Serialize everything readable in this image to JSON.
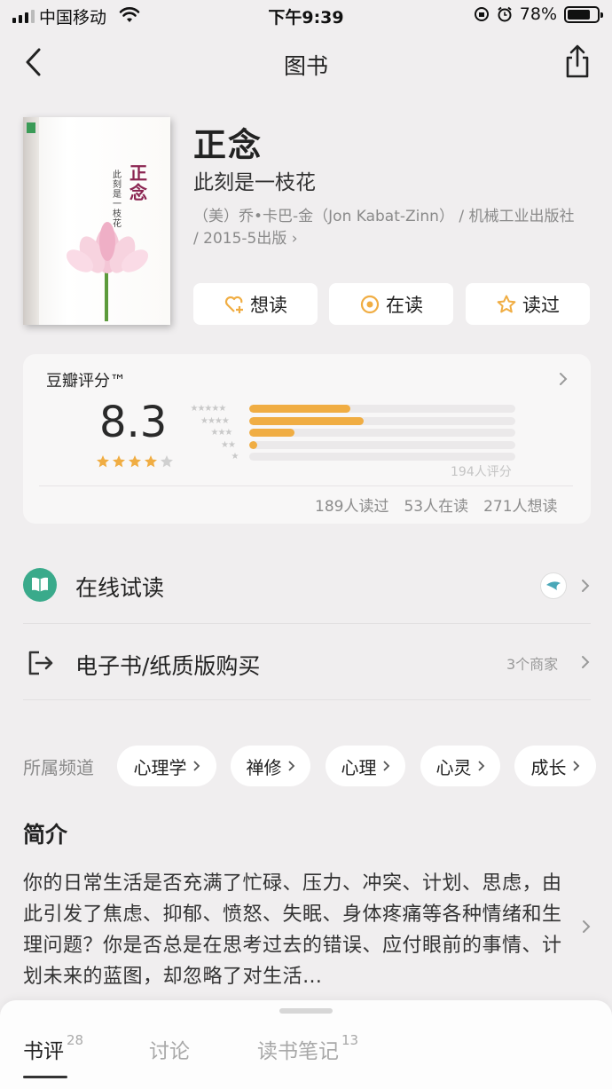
{
  "status_bar": {
    "carrier": "中国移动",
    "time": "下午9:39",
    "battery": "78%",
    "battery_level": 0.78
  },
  "nav": {
    "title": "图书"
  },
  "book": {
    "cover_title": "正念",
    "cover_subtitle": "此刻是一枝花",
    "title": "正念",
    "subtitle": "此刻是一枝花",
    "meta": "（美）乔•卡巴-金（Jon Kabat-Zinn） / 机械工业出版社 / 2015-5出版 ›"
  },
  "actions": {
    "want": "想读",
    "reading": "在读",
    "read": "读过"
  },
  "rating": {
    "label": "豆瓣评分™",
    "score": "8.3",
    "stars": 4,
    "histogram": [
      {
        "stars": 5,
        "fraction": 0.38
      },
      {
        "stars": 4,
        "fraction": 0.43
      },
      {
        "stars": 3,
        "fraction": 0.17
      },
      {
        "stars": 2,
        "fraction": 0.03
      },
      {
        "stars": 1,
        "fraction": 0.0
      }
    ],
    "count": "194人评分",
    "read_count": "189人读过",
    "reading_count": "53人在读",
    "want_count": "271人想读",
    "accent": "#f0ad43"
  },
  "rows": {
    "online": "在线试读",
    "buy": "电子书/纸质版购买",
    "merchants": "3个商家"
  },
  "channels": {
    "label": "所属频道",
    "items": [
      "心理学",
      "禅修",
      "心理",
      "心灵",
      "成长"
    ]
  },
  "intro": {
    "heading": "简介",
    "text": "你的日常生活是否充满了忙碌、压力、冲突、计划、思虑，由此引发了焦虑、抑郁、愤怒、失眠、身体疼痛等各种情绪和生理问题？你是否总是在思考过去的错误、应付眼前的事情、计划未来的蓝图，却忽略了对生活…"
  },
  "tabs": [
    {
      "label": "书评",
      "count": "28"
    },
    {
      "label": "讨论",
      "count": ""
    },
    {
      "label": "读书笔记",
      "count": "13"
    }
  ]
}
